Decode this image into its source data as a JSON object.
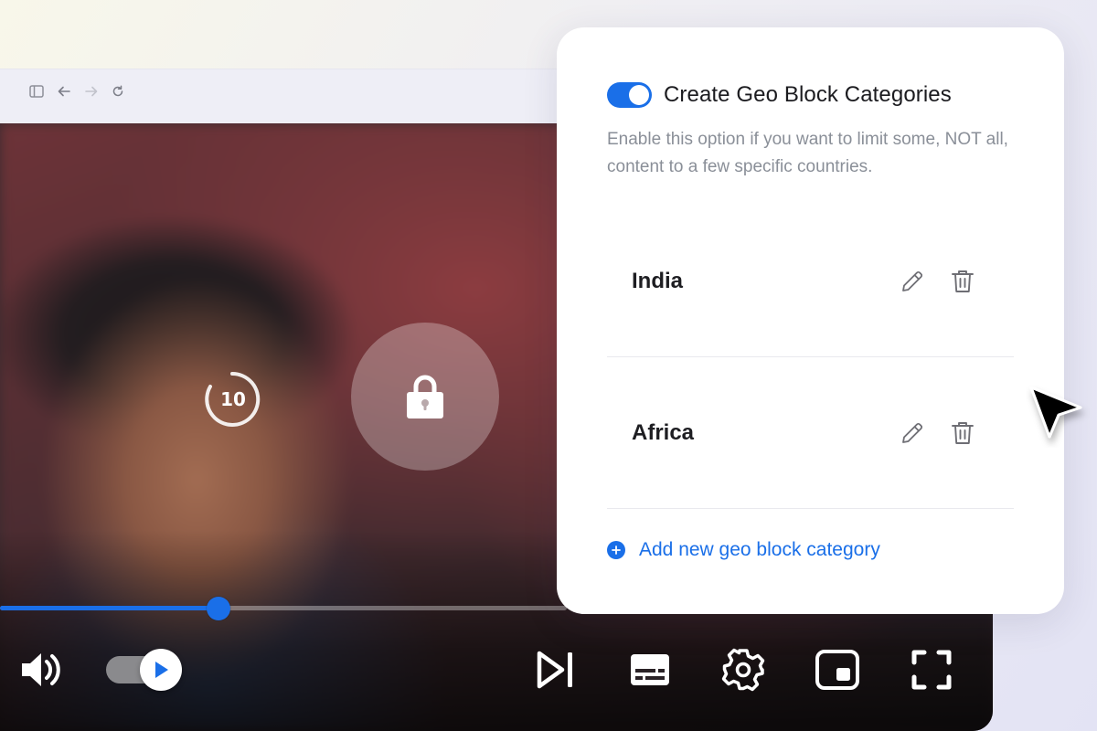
{
  "browser": {
    "icons": [
      "sidebar-icon",
      "back-arrow-icon",
      "forward-arrow-icon",
      "reload-icon"
    ]
  },
  "player": {
    "rewind_seconds": "10",
    "progress_fraction": 0.385,
    "accent_color": "#1a6fe8",
    "controls": [
      "volume-icon",
      "autoplay-toggle",
      "skip-next-icon",
      "subtitles-icon",
      "settings-gear-icon",
      "picture-in-picture-icon",
      "fullscreen-icon"
    ]
  },
  "geo_block": {
    "enabled": true,
    "title": "Create Geo Block Categories",
    "description": "Enable this option if you want to limit some, NOT all, content to a few specific countries.",
    "categories": [
      {
        "label": "India"
      },
      {
        "label": "Africa"
      }
    ],
    "add_label": "Add new geo block category"
  }
}
